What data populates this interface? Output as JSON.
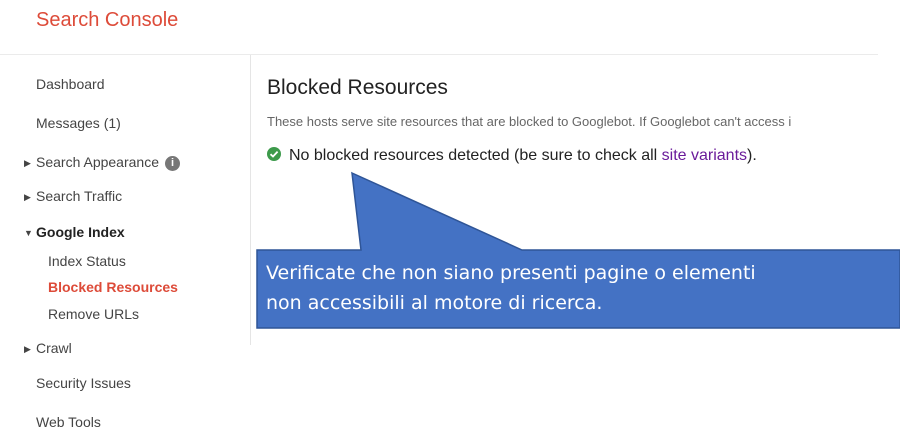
{
  "app": {
    "title": "Search Console"
  },
  "sidebar": {
    "items": [
      {
        "label": "Dashboard"
      },
      {
        "label": "Messages (1)"
      },
      {
        "label": "Search Appearance"
      },
      {
        "label": "Search Traffic"
      },
      {
        "label": "Google Index"
      },
      {
        "label": "Index Status"
      },
      {
        "label": "Blocked Resources"
      },
      {
        "label": "Remove URLs"
      },
      {
        "label": "Crawl"
      },
      {
        "label": "Security Issues"
      },
      {
        "label": "Web Tools"
      }
    ],
    "info_icon_glyph": "i"
  },
  "main": {
    "title": "Blocked Resources",
    "description": "These hosts serve site resources that are blocked to Googlebot. If Googlebot can't access i",
    "status_text": "No blocked resources detected (be sure to check all ",
    "status_link": "site variants",
    "status_end": ")."
  },
  "callout": {
    "line1": "Verificate che non siano presenti pagine o elementi",
    "line2": "non accessibili al motore di ricerca.",
    "color": "#4472c4"
  },
  "colors": {
    "brand": "#dd4b39",
    "active": "#dd4b39",
    "link": "#6a1b9a",
    "success": "#3d9a4b"
  }
}
